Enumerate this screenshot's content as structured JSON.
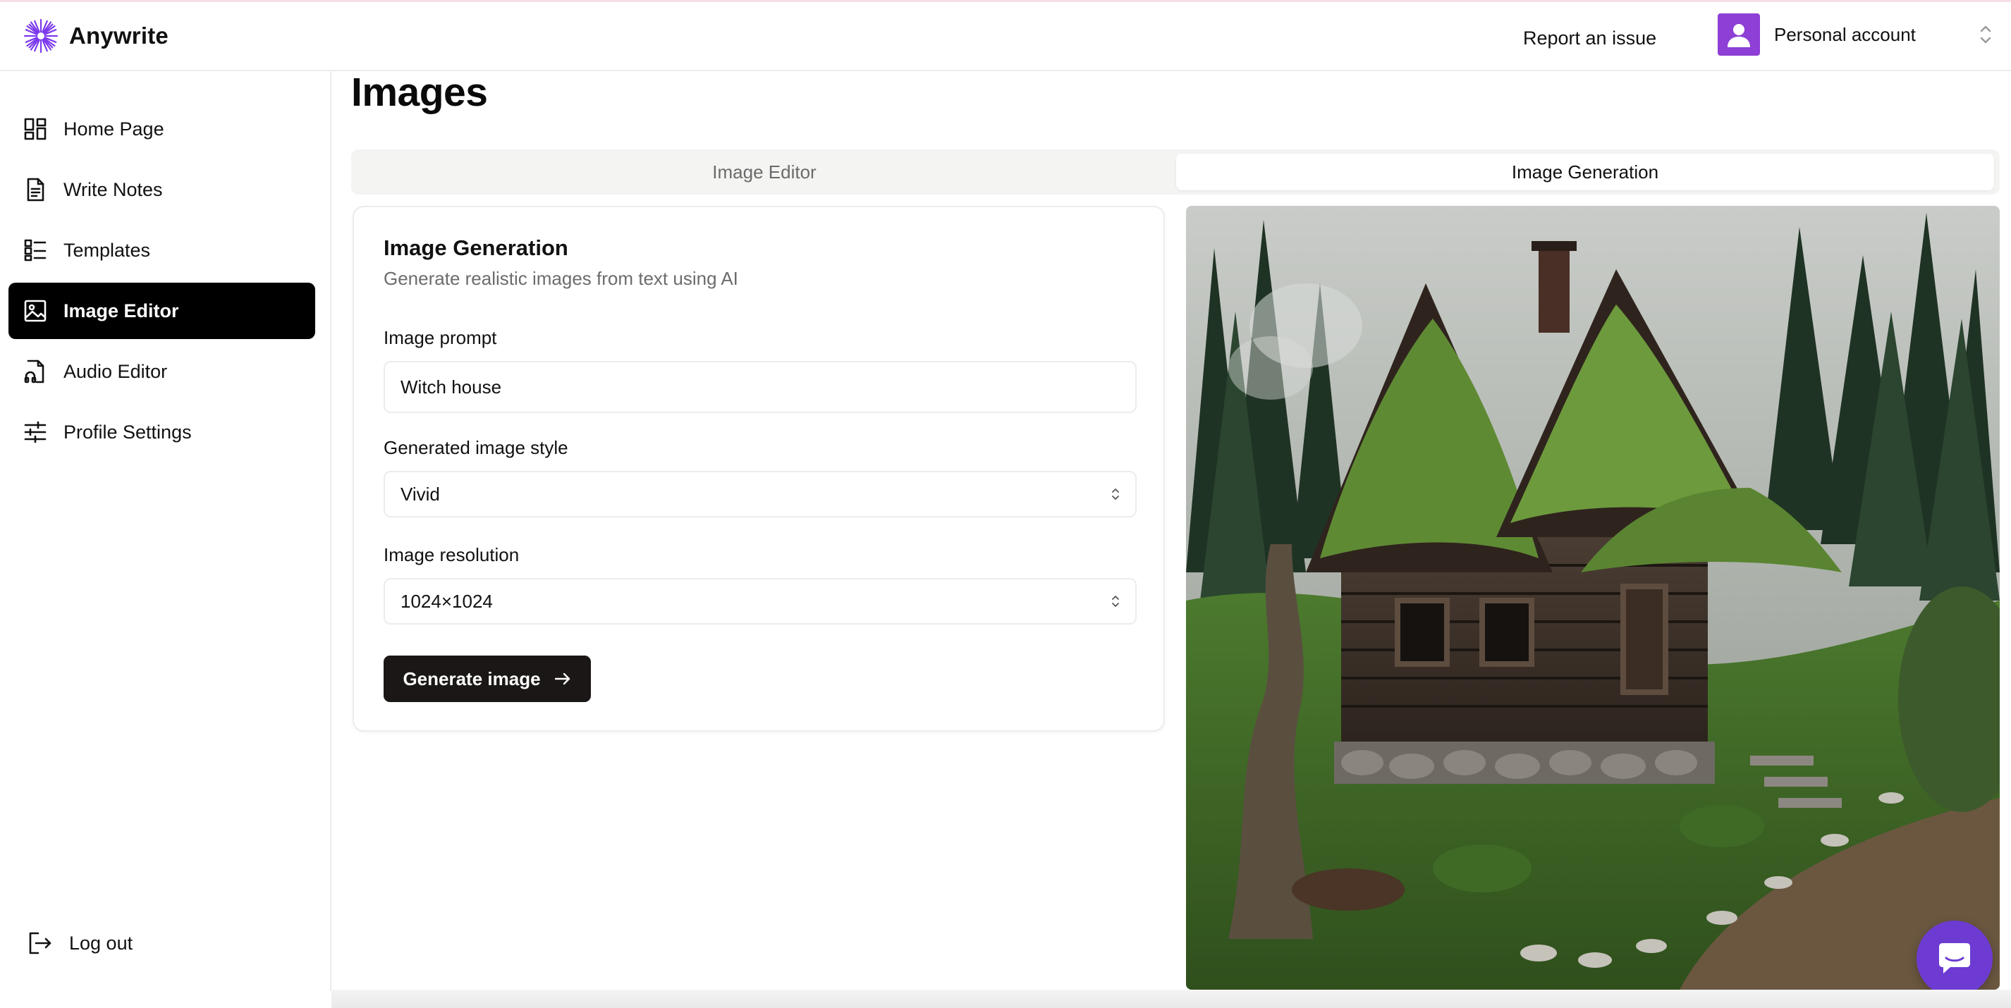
{
  "app": {
    "name": "Anywrite",
    "logo_icon": "sunburst-logo",
    "accent": "#7c3aed"
  },
  "header": {
    "report_label": "Report an issue",
    "account_label": "Personal account",
    "account_avatar_color": "#8e3fd6"
  },
  "sidebar": {
    "items": [
      {
        "label": "Home Page",
        "icon": "dashboard-icon",
        "active": false
      },
      {
        "label": "Write Notes",
        "icon": "document-icon",
        "active": false
      },
      {
        "label": "Templates",
        "icon": "list-icon",
        "active": false
      },
      {
        "label": "Image Editor",
        "icon": "image-icon",
        "active": true
      },
      {
        "label": "Audio Editor",
        "icon": "audio-file-icon",
        "active": false
      },
      {
        "label": "Profile Settings",
        "icon": "sliders-icon",
        "active": false
      }
    ],
    "logout_label": "Log out"
  },
  "main": {
    "title": "Images",
    "tabs": [
      {
        "label": "Image Editor",
        "active": false
      },
      {
        "label": "Image Generation",
        "active": true
      }
    ],
    "card": {
      "title": "Image Generation",
      "subtitle": "Generate realistic images from text using AI",
      "prompt_label": "Image prompt",
      "prompt_value": "Witch house",
      "style_label": "Generated image style",
      "style_value": "Vivid",
      "resolution_label": "Image resolution",
      "resolution_value": "1024×1024",
      "generate_label": "Generate image"
    },
    "generated_image": {
      "subject": "moss-roofed wooden witch house in a forest"
    }
  },
  "chat": {
    "icon": "chat-icon",
    "color": "#6d3bd2"
  }
}
